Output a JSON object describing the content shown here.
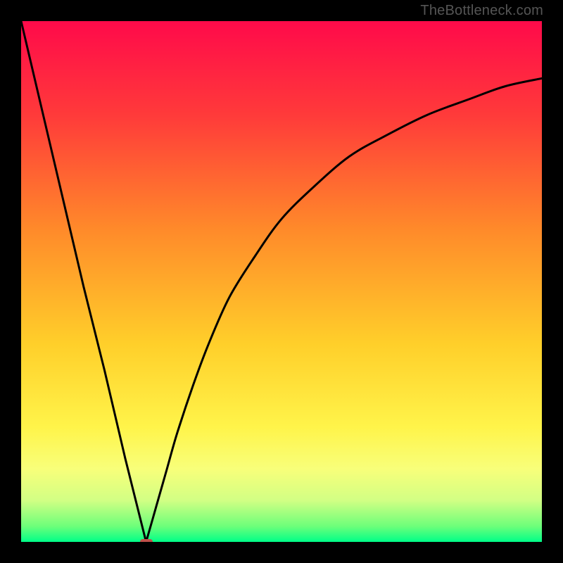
{
  "watermark": "TheBottleneck.com",
  "colors": {
    "black": "#000000",
    "marker": "#c0504a",
    "curve": "#000000",
    "gradient_stops": [
      {
        "pct": 0,
        "color": "#ff0a4a"
      },
      {
        "pct": 18,
        "color": "#ff3a3a"
      },
      {
        "pct": 40,
        "color": "#ff8a2a"
      },
      {
        "pct": 62,
        "color": "#ffcf2a"
      },
      {
        "pct": 78,
        "color": "#fff44a"
      },
      {
        "pct": 86,
        "color": "#f8ff7a"
      },
      {
        "pct": 92,
        "color": "#d2ff84"
      },
      {
        "pct": 97,
        "color": "#6dff7a"
      },
      {
        "pct": 100,
        "color": "#00ff88"
      }
    ]
  },
  "chart_data": {
    "type": "line",
    "title": "",
    "xlabel": "",
    "ylabel": "",
    "xlim": [
      0,
      100
    ],
    "ylim": [
      0,
      100
    ],
    "min_point": {
      "x": 24,
      "y": 0
    },
    "series": [
      {
        "name": "left-branch",
        "x": [
          0,
          4,
          8,
          12,
          16,
          20,
          24
        ],
        "y": [
          100,
          83,
          66,
          49,
          33,
          16,
          0
        ]
      },
      {
        "name": "right-branch",
        "x": [
          24,
          26,
          28,
          30,
          33,
          36,
          40,
          45,
          50,
          56,
          63,
          70,
          78,
          86,
          93,
          100
        ],
        "y": [
          0,
          7,
          14,
          21,
          30,
          38,
          47,
          55,
          62,
          68,
          74,
          78,
          82,
          85,
          87.5,
          89
        ]
      }
    ]
  }
}
